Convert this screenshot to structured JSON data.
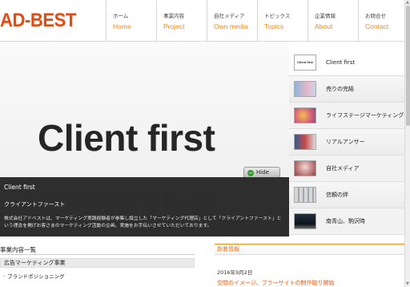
{
  "logo": "AD-BEST",
  "nav": [
    {
      "ja": "ホーム",
      "en": "Home"
    },
    {
      "ja": "事業内容",
      "en": "Project"
    },
    {
      "ja": "自社メディア",
      "en": "Own media"
    },
    {
      "ja": "トピックス",
      "en": "Topics"
    },
    {
      "ja": "企業情報",
      "en": "About"
    },
    {
      "ja": "お問合せ",
      "en": "Contact"
    }
  ],
  "hero": {
    "title": "Client first",
    "hide_label": "Hide",
    "caption_heading": "Client first",
    "caption_sub": "クライアントファースト",
    "caption_text": "株式会社アドベストは、マーケティング実践経験者が参集し設立した「マーケティング代理店」として「クライアントファースト」という理念を掲げお客さまのマーケティング活動の企画、実施をお手伝いさせていただいております。"
  },
  "thumbs": [
    {
      "label": "Client first",
      "img_text": "Client first"
    },
    {
      "label": "売りの完結"
    },
    {
      "label": "ライフステージマーケティング"
    },
    {
      "label": "リアルアンサー"
    },
    {
      "label": "自社メディア"
    },
    {
      "label": "信頼の絆"
    },
    {
      "label": "南青山、駒沢時"
    }
  ],
  "business": {
    "heading": "事業内容一覧",
    "item1": "広告マーケティング事業",
    "item2": "ブランドポジショニング"
  },
  "news": {
    "heading": "新着情報",
    "date": "2016年9月2日",
    "link": "空間のイメージ、ブラーサイトの制作取り開始"
  }
}
